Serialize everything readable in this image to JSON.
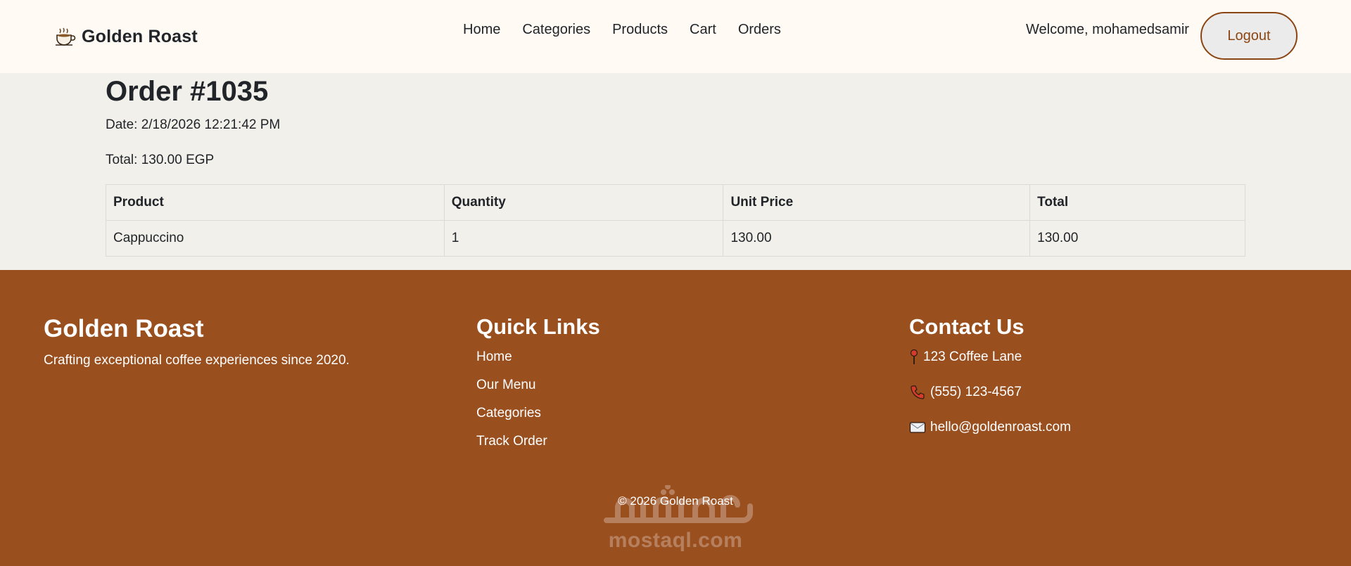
{
  "navbar": {
    "brand_name": "Golden Roast",
    "links": [
      "Home",
      "Categories",
      "Products",
      "Cart",
      "Orders"
    ],
    "welcome_text": "Welcome, mohamedsamir",
    "logout_label": "Logout"
  },
  "order": {
    "title": "Order #1035",
    "date_text": "Date: 2/18/2026 12:21:42 PM",
    "total_text": "Total: 130.00 EGP",
    "table": {
      "headers": [
        "Product",
        "Quantity",
        "Unit Price",
        "Total"
      ],
      "rows": [
        [
          "Cappuccino",
          "1",
          "130.00",
          "130.00"
        ]
      ]
    }
  },
  "footer": {
    "brand_title": "Golden Roast",
    "tagline": "Crafting exceptional coffee experiences since 2020.",
    "quick_links_heading": "Quick Links",
    "quick_links": [
      "Home",
      "Our Menu",
      "Categories",
      "Track Order"
    ],
    "contact_heading": "Contact Us",
    "contact": {
      "address": "123 Coffee Lane",
      "phone": "(555) 123-4567",
      "email": "hello@goldenroast.com"
    },
    "copyright": "© 2026 Golden Roast"
  },
  "watermark": {
    "text": "mostaql.com"
  },
  "icons": {
    "brand": "coffee-cup-icon",
    "address": "pin-icon",
    "phone": "phone-icon",
    "email": "envelope-icon"
  },
  "colors": {
    "nav_bg": "#fffaf4",
    "page_bg": "#f2f0ea",
    "footer_bg": "#9a4f1f",
    "accent": "#8b4513"
  }
}
